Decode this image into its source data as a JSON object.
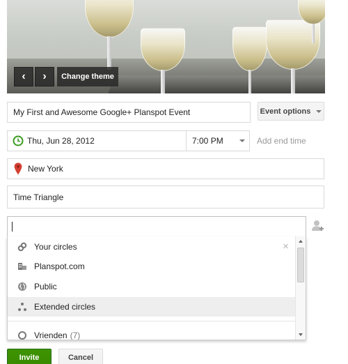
{
  "theme": {
    "change_theme_label": "Change theme",
    "prev_label": "‹",
    "next_label": "›"
  },
  "event": {
    "title_value": "My First and Awesome Google+ Planspot Event",
    "event_options_label": "Event options",
    "date_value": "Thu, Jun 28, 2012",
    "time_value": "7:00 PM",
    "add_end_time_label": "Add end time",
    "location_value": "New York",
    "details_value": "Time Triangle"
  },
  "invite": {
    "input_value": "",
    "add_person_icon": "add-person-icon"
  },
  "circles_dropdown": {
    "items": [
      {
        "label": "Your circles",
        "icon": "link-icon",
        "count": ""
      },
      {
        "label": "Planspot.com",
        "icon": "domain-icon",
        "count": ""
      },
      {
        "label": "Public",
        "icon": "globe-icon",
        "count": ""
      },
      {
        "label": "Extended circles",
        "icon": "extended-circles-icon",
        "count": ""
      },
      {
        "label": "Vrienden",
        "icon": "circle-icon",
        "count": "(7)"
      }
    ],
    "close_label": "×"
  },
  "actions": {
    "invite_label": "Invite",
    "cancel_label": "Cancel"
  },
  "colors": {
    "invite_green": "#3d9400",
    "clock_green": "#3a9b1e",
    "pin_red": "#d23f31"
  }
}
